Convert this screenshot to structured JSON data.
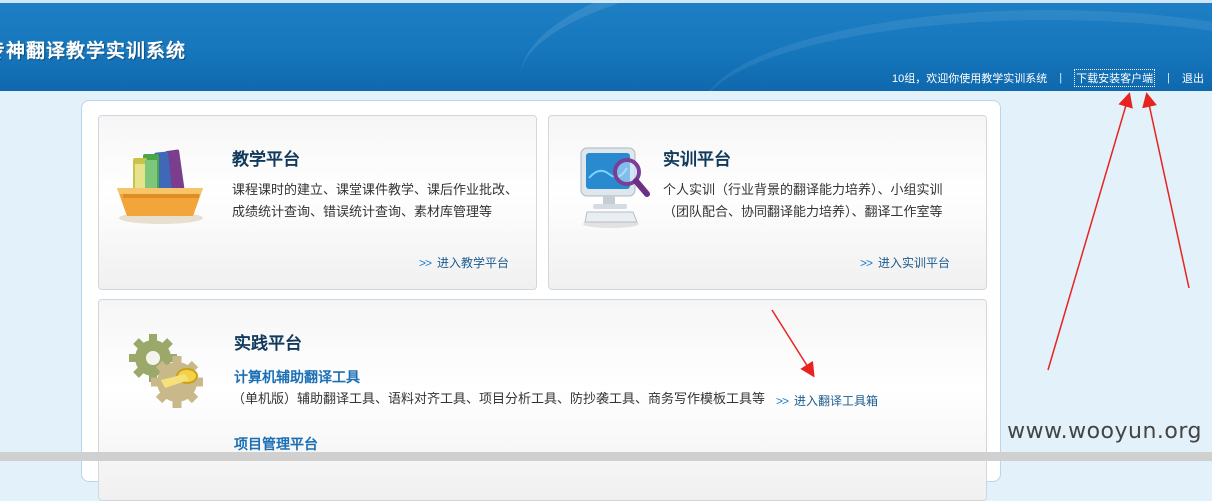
{
  "header": {
    "app_title": "专神翻译教学实训系统",
    "welcome": "10组，欢迎你使用教学实训系统",
    "download_link": "下载安装客户端",
    "logout": "退出",
    "separator": "|"
  },
  "cards": {
    "teaching": {
      "title": "教学平台",
      "desc_line1": "课程课时的建立、课堂课件教学、课后作业批改、",
      "desc_line2": "成绩统计查询、错误统计查询、素材库管理等",
      "link_arrow": ">>",
      "link": "进入教学平台",
      "icon": "books-icon"
    },
    "training": {
      "title": "实训平台",
      "desc_line1": "个人实训（行业背景的翻译能力培养）、小组实训",
      "desc_line2": "（团队配合、协同翻译能力培养）、翻译工作室等",
      "link_arrow": ">>",
      "link": "进入实训平台",
      "icon": "computer-magnifier-icon"
    },
    "practice": {
      "title": "实践平台",
      "cat_tool_heading": "计算机辅助翻译工具",
      "cat_tool_desc": "（单机版）辅助翻译工具、语料对齐工具、项目分析工具、防抄袭工具、商务写作模板工具等",
      "link_arrow": ">>",
      "link": "进入翻译工具箱",
      "pm_heading": "项目管理平台",
      "icon": "gears-icon"
    }
  },
  "watermark": "www.wooyun.org",
  "colors": {
    "header_blue": "#1677bd",
    "title_dark": "#10395c",
    "link_blue": "#1c5c8f",
    "annotation_red": "#e8231f"
  }
}
